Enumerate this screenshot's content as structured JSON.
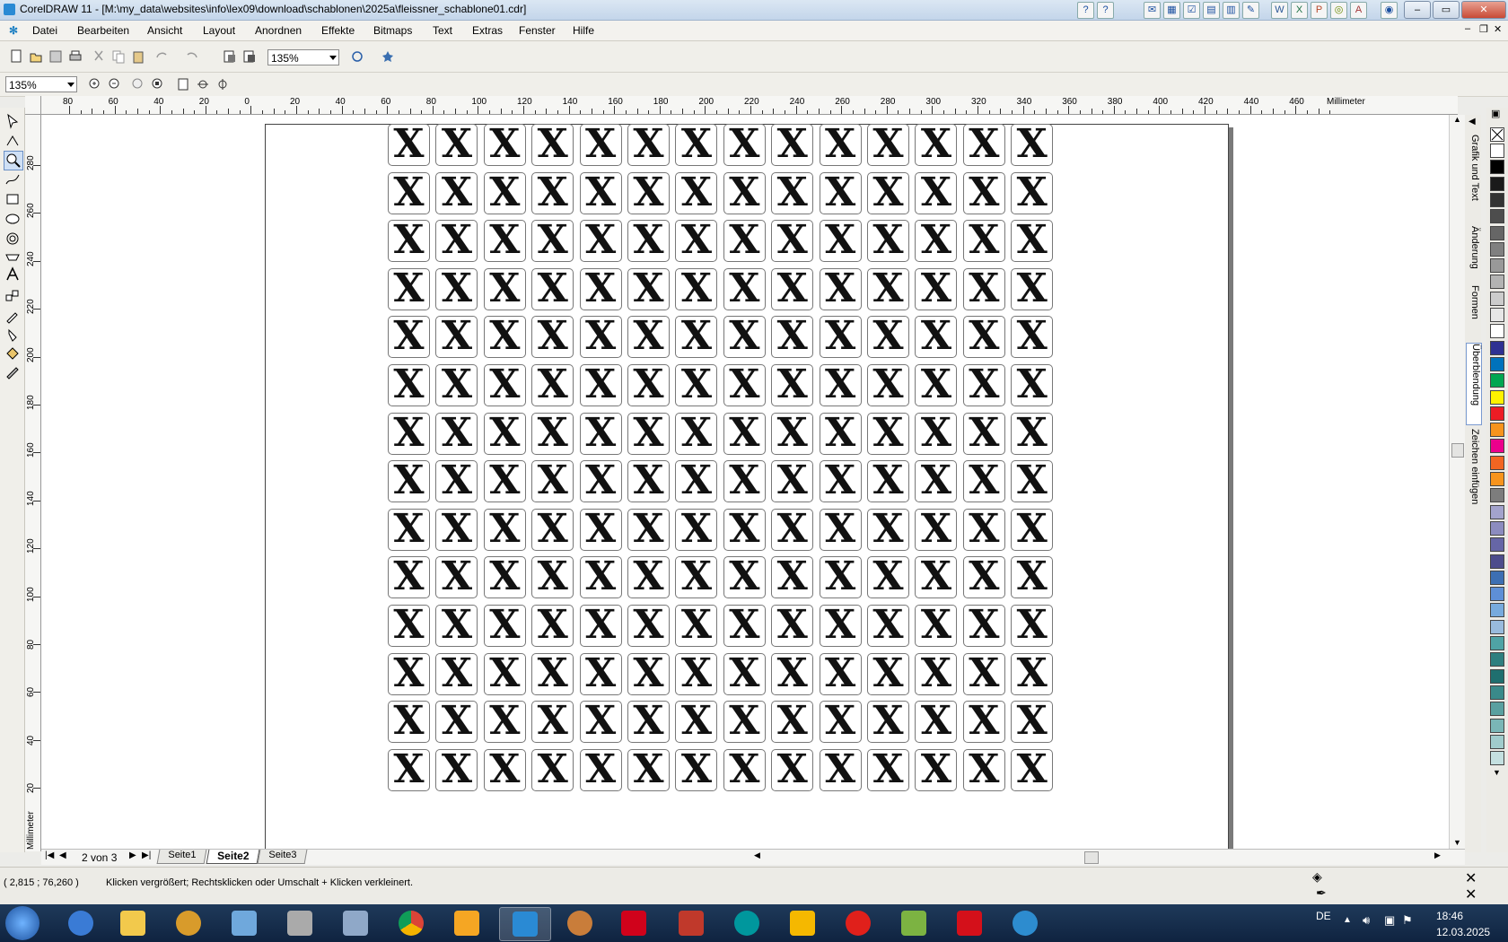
{
  "window": {
    "title": "CorelDRAW 11 - [M:\\my_data\\websites\\info\\lex09\\download\\schablonen\\2025a\\fleissner_schablone01.cdr]"
  },
  "menu": [
    "Datei",
    "Bearbeiten",
    "Ansicht",
    "Layout",
    "Anordnen",
    "Effekte",
    "Bitmaps",
    "Text",
    "Extras",
    "Fenster",
    "Hilfe"
  ],
  "toolbar": {
    "zoom_value": "135%"
  },
  "zoombar": {
    "zoom_value": "135%"
  },
  "ruler": {
    "h_labels": [
      "80",
      "60",
      "40",
      "20",
      "0",
      "20",
      "40",
      "60",
      "80",
      "100",
      "120",
      "140",
      "160",
      "180",
      "200",
      "220",
      "240",
      "260",
      "280",
      "300",
      "320",
      "340",
      "360",
      "380",
      "400",
      "420",
      "440",
      "460"
    ],
    "h_unit": "Millimeter",
    "v_labels": [
      "280",
      "260",
      "240",
      "220",
      "200",
      "180",
      "160",
      "140",
      "120",
      "100",
      "80",
      "60",
      "40",
      "20"
    ],
    "v_unit": "Millimeter"
  },
  "grid": {
    "glyph": "X",
    "rows": 14,
    "cols": 14
  },
  "pages": {
    "counter": "2 von 3",
    "tabs": [
      {
        "label": "Seite1",
        "active": false
      },
      {
        "label": "Seite2",
        "active": true
      },
      {
        "label": "Seite3",
        "active": false
      }
    ]
  },
  "dockers": [
    "Grafik und Text",
    "Änderung",
    "Formen",
    "Überblendung",
    "Zeichen einfügen"
  ],
  "palette": [
    "#ffffff",
    "#000000",
    "#1a1a1a",
    "#333333",
    "#4d4d4d",
    "#666666",
    "#808080",
    "#999999",
    "#b3b3b3",
    "#cccccc",
    "#e6e6e6",
    "#ffffff",
    "#2e3192",
    "#0072bc",
    "#00a651",
    "#fff200",
    "#ed1c24",
    "#f7941d",
    "#ec008c",
    "#f26522",
    "#f7941d",
    "#7d7d7d",
    "#a3a3cc",
    "#8c8cbf",
    "#6666a6",
    "#4d4d8c",
    "#3d6fb3",
    "#5e8fd6",
    "#77aadd",
    "#99bbdd",
    "#4fa3a5",
    "#2f7f7f",
    "#1f6f6f",
    "#3a8a8a",
    "#5aa0a0",
    "#7ab6b6",
    "#a0cccc",
    "#c4e0e0"
  ],
  "status": {
    "coords": "( 2,815 ; 76,260 )",
    "message": "Klicken vergrößert; Rechtsklicken oder Umschalt + Klicken verkleinert."
  },
  "taskbar": {
    "language": "DE",
    "time": "18:46",
    "date": "12.03.2025"
  }
}
